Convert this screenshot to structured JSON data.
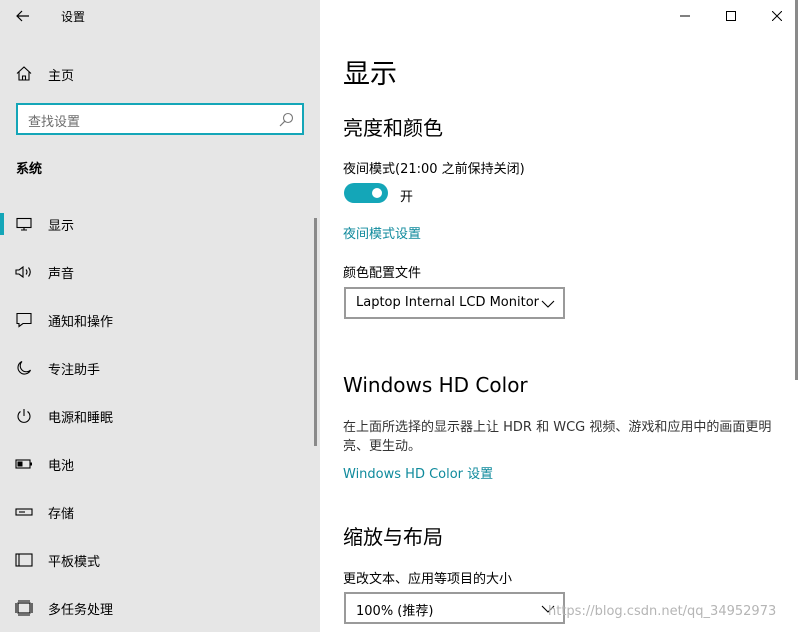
{
  "window": {
    "title": "设置",
    "controls": [
      "minimize",
      "maximize",
      "close"
    ]
  },
  "sidebar": {
    "home_label": "主页",
    "search_placeholder": "查找设置",
    "section_title": "系统",
    "items": [
      {
        "label": "显示",
        "icon": "monitor-icon",
        "active": true
      },
      {
        "label": "声音",
        "icon": "speaker-icon"
      },
      {
        "label": "通知和操作",
        "icon": "notification-icon"
      },
      {
        "label": "专注助手",
        "icon": "moon-icon"
      },
      {
        "label": "电源和睡眠",
        "icon": "power-icon"
      },
      {
        "label": "电池",
        "icon": "battery-icon"
      },
      {
        "label": "存储",
        "icon": "storage-icon"
      },
      {
        "label": "平板模式",
        "icon": "tablet-icon"
      },
      {
        "label": "多任务处理",
        "icon": "multitask-icon"
      }
    ]
  },
  "main": {
    "title": "显示",
    "brightness": {
      "heading": "亮度和颜色",
      "night_light_label": "夜间模式(21:00 之前保持关闭)",
      "toggle_state": "开",
      "night_light_link": "夜间模式设置",
      "color_profile_label": "颜色配置文件",
      "color_profile_value": "Laptop Internal LCD Monitor"
    },
    "hdr": {
      "heading": "Windows HD Color",
      "description": "在上面所选择的显示器上让 HDR 和 WCG 视频、游戏和应用中的画面更明亮、更生动。",
      "link": "Windows HD Color 设置"
    },
    "scale": {
      "heading": "缩放与布局",
      "label": "更改文本、应用等项目的大小",
      "value": "100% (推荐)"
    }
  },
  "watermark": "https://blog.csdn.net/qq_34952973",
  "colors": {
    "accent": "#14a6b8",
    "link": "#0f8a9c",
    "sidebar_bg": "#e6e6e6"
  }
}
